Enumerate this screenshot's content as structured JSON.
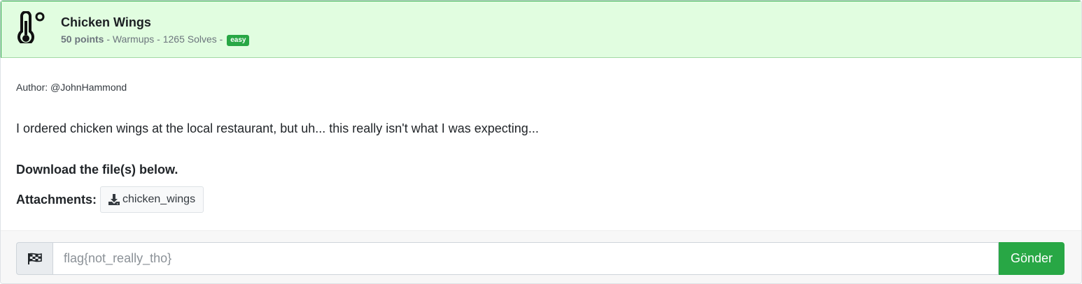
{
  "challenge": {
    "title": "Chicken Wings",
    "points": "50 points",
    "category": "- Warmups -",
    "solves": "1265 Solves -",
    "difficulty": "easy",
    "category_icon": "thermometer-icon"
  },
  "body": {
    "author": "Author: @JohnHammond",
    "description": "I ordered chicken wings at the local restaurant, but uh... this really isn't what I was expecting...",
    "download_note": "Download the file(s) below.",
    "attachments_label": "Attachments:",
    "attachments": [
      {
        "name": "chicken_wings",
        "icon": "download-icon"
      }
    ]
  },
  "submission": {
    "icon": "checkered-flag-icon",
    "placeholder": "flag{not_really_tho}",
    "value": "",
    "submit_label": "Gönder"
  },
  "colors": {
    "header_bg": "#e1fde0",
    "accent_green": "#28a745"
  }
}
